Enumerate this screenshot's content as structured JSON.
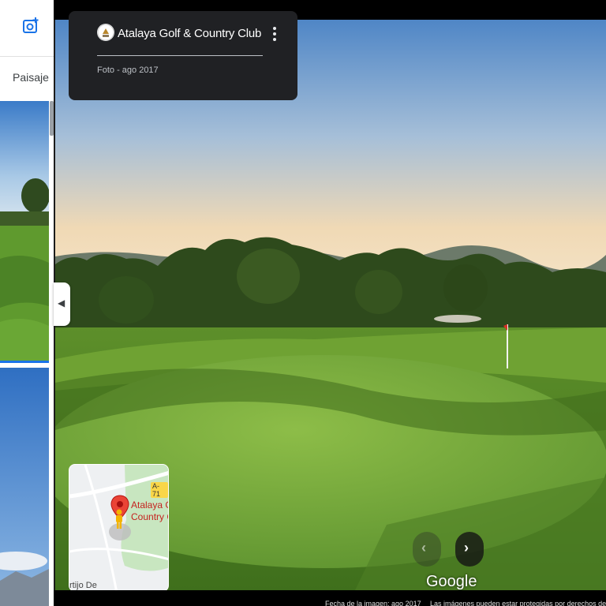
{
  "left_panel": {
    "tab_label": "Paisaje"
  },
  "title_card": {
    "title": "Atalaya Golf & Country Club",
    "photo_date": "Foto - ago 2017"
  },
  "mini_map": {
    "road_label": "A-71",
    "place_label_line1": "Atalaya G",
    "place_label_line2": "Country C",
    "area_label": "rtijo De"
  },
  "viewer": {
    "logo_text": "Google"
  },
  "bottom_bar": {
    "image_date": "Fecha de la imagen: ago 2017",
    "copyright": "Las imágenes pueden estar protegidas por derechos de"
  },
  "icons": {
    "add_photo": "add-photo-icon",
    "more": "more-vert-icon",
    "collapse": "chevron-left-icon",
    "prev": "chevron-left-icon",
    "next": "chevron-right-icon",
    "map_pin": "map-pin-icon",
    "pegman": "pegman-icon"
  },
  "colors": {
    "card_bg": "#202124",
    "accent_blue": "#1a73e8",
    "pin_red": "#ea4335"
  }
}
